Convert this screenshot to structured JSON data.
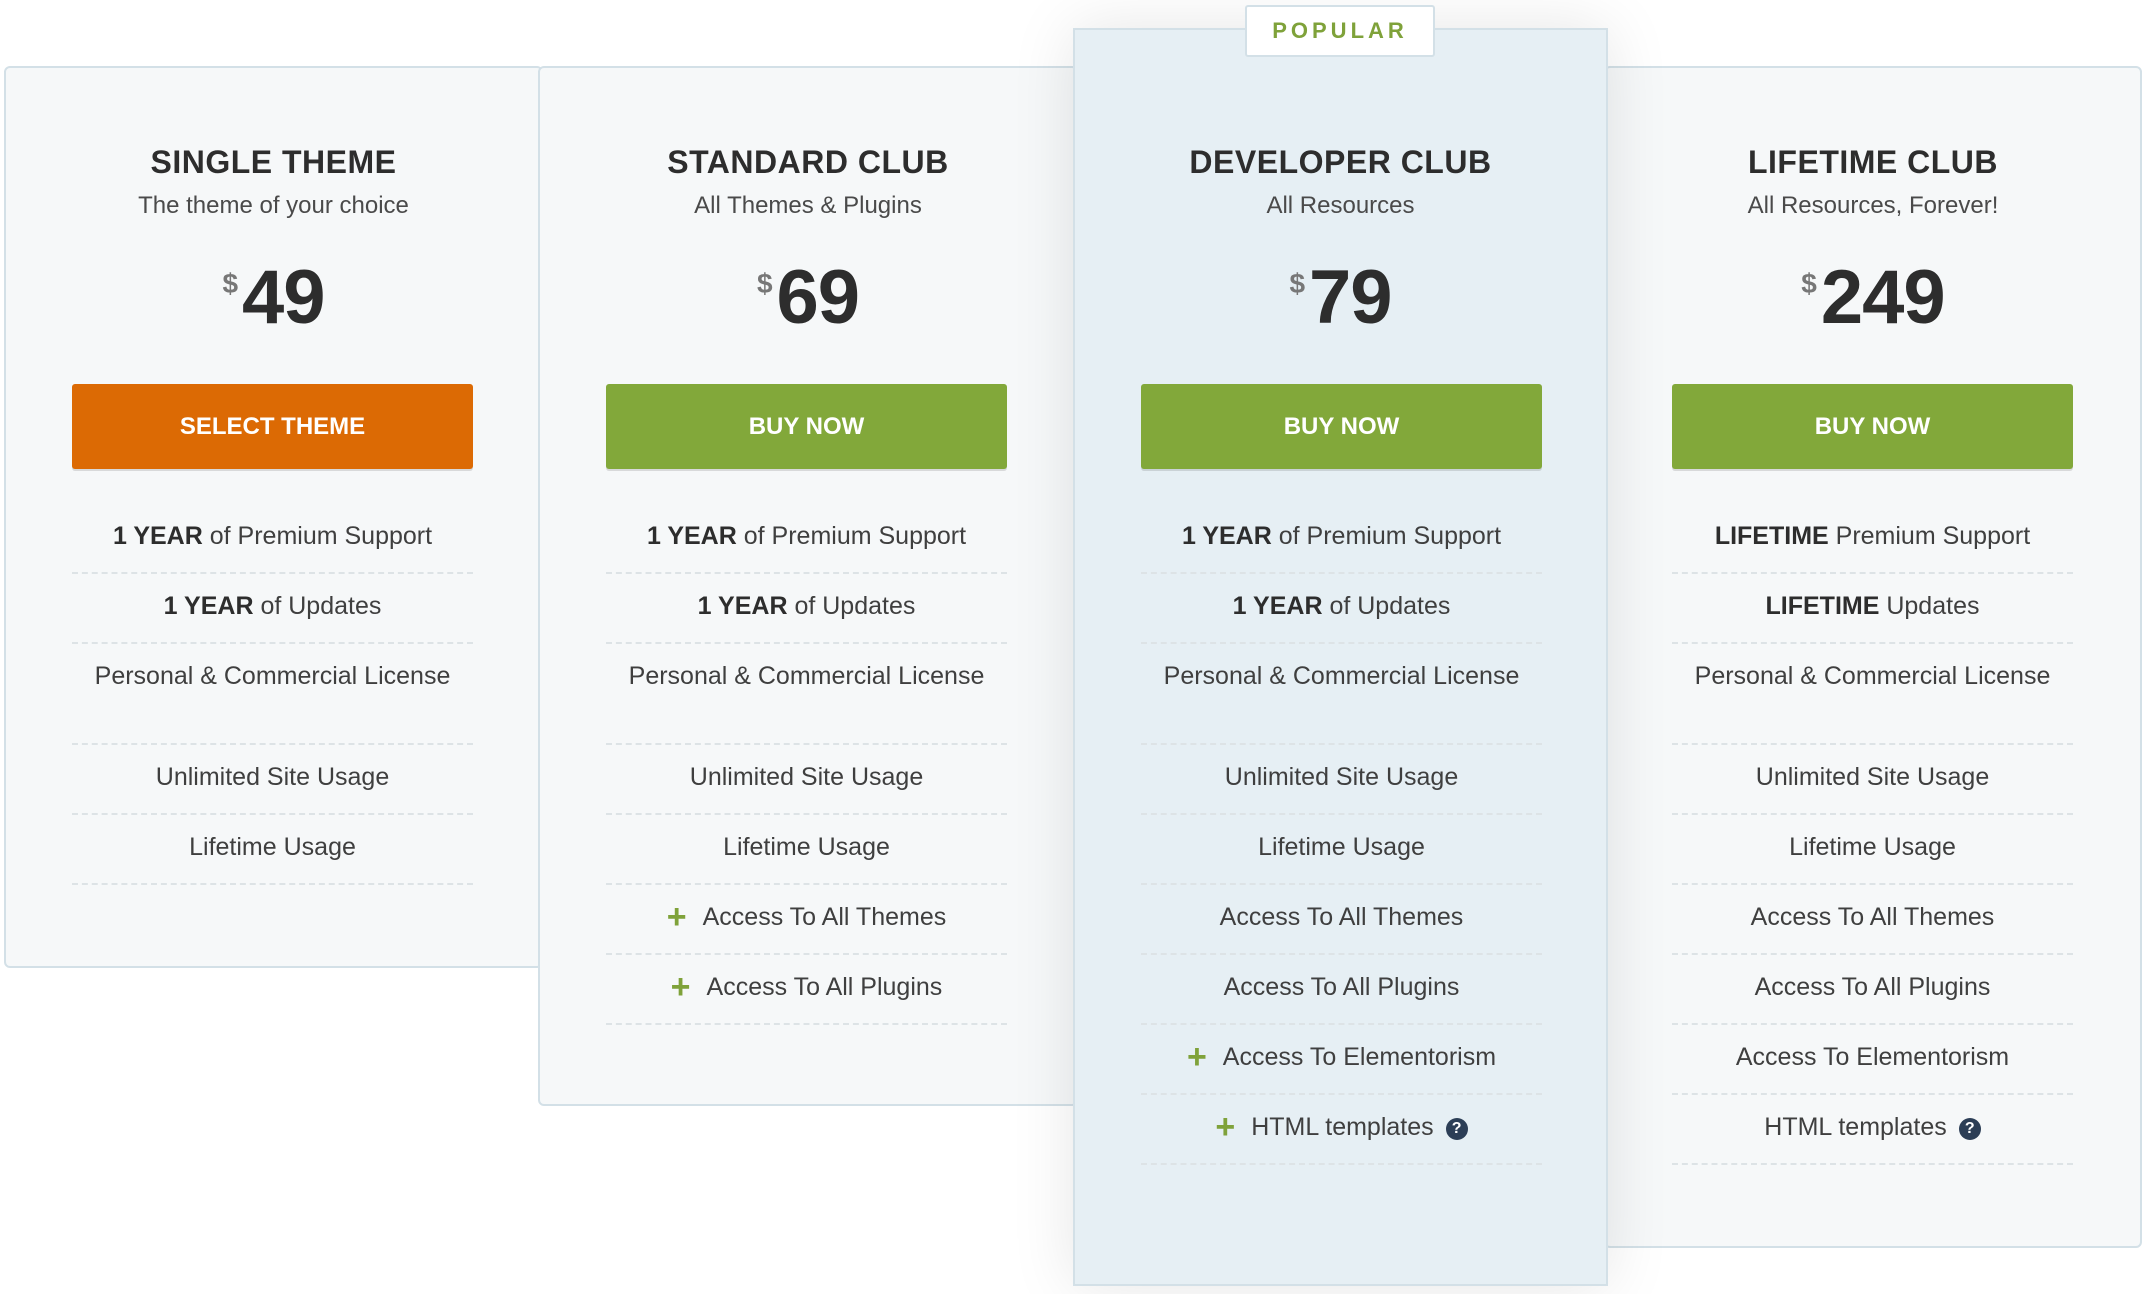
{
  "popular_badge": "POPULAR",
  "currency_symbol": "$",
  "plans": [
    {
      "name": "SINGLE THEME",
      "subtitle": "The theme of your choice",
      "price": "49",
      "button": "SELECT THEME",
      "features": {
        "support_bold": "1 YEAR",
        "support_text": " of Premium Support",
        "updates_bold": "1 YEAR",
        "updates_text": " of Updates",
        "license": "Personal & Commercial License",
        "site_usage": "Unlimited Site Usage",
        "lifetime_usage": "Lifetime Usage"
      }
    },
    {
      "name": "STANDARD CLUB",
      "subtitle": "All Themes & Plugins",
      "price": "69",
      "button": "BUY NOW",
      "features": {
        "support_bold": "1 YEAR",
        "support_text": " of Premium Support",
        "updates_bold": "1 YEAR",
        "updates_text": " of Updates",
        "license": "Personal & Commercial License",
        "site_usage": "Unlimited Site Usage",
        "lifetime_usage": "Lifetime Usage",
        "themes": "Access To All Themes",
        "plugins": "Access To All Plugins"
      }
    },
    {
      "name": "DEVELOPER CLUB",
      "subtitle": "All Resources",
      "price": "79",
      "button": "BUY NOW",
      "features": {
        "support_bold": "1 YEAR",
        "support_text": " of Premium Support",
        "updates_bold": "1 YEAR",
        "updates_text": " of Updates",
        "license": "Personal & Commercial License",
        "site_usage": "Unlimited Site Usage",
        "lifetime_usage": "Lifetime Usage",
        "themes": "Access To All Themes",
        "plugins": "Access To All Plugins",
        "elementorism": "Access To Elementorism",
        "html_templates": "HTML templates"
      }
    },
    {
      "name": "LIFETIME CLUB",
      "subtitle": "All Resources, Forever!",
      "price": "249",
      "button": "BUY NOW",
      "features": {
        "support_bold": "LIFETIME",
        "support_text": " Premium Support",
        "updates_bold": "LIFETIME",
        "updates_text": " Updates",
        "license": "Personal & Commercial License",
        "site_usage": "Unlimited Site Usage",
        "lifetime_usage": "Lifetime Usage",
        "themes": "Access To All Themes",
        "plugins": "Access To All Plugins",
        "elementorism": "Access To Elementorism",
        "html_templates": "HTML templates"
      }
    }
  ],
  "help_icon_glyph": "?",
  "plus_icon_glyph": "+",
  "colors": {
    "orange_button": "#dc6a04",
    "green_button": "#82a83a",
    "accent_green": "#7fa23a",
    "popular_bg": "#e6eff4",
    "card_bg": "#f6f8f9"
  }
}
